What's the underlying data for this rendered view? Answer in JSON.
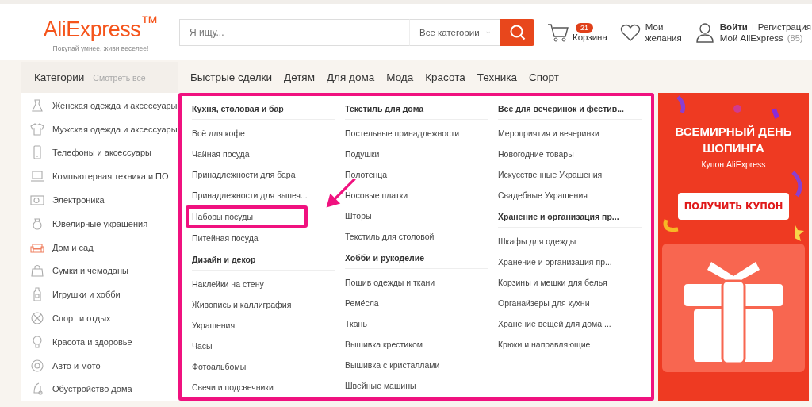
{
  "header": {
    "logo": "AliExpress$^{™}$",
    "tagline": "Покупай умнее, живи веселее!",
    "search": {
      "placeholder": "Я ищу...",
      "category": "Все категории"
    },
    "cart": {
      "count": "21",
      "label": "Корзина"
    },
    "wishlist": {
      "label": "Мои желания"
    },
    "account": {
      "login": "Войти",
      "separator": "|",
      "register": "Регистрация",
      "my": "Мой AliExpress",
      "count": "(85)"
    }
  },
  "categories": {
    "title": "Категории",
    "see_all": "Смотреть все",
    "items": [
      {
        "label": "Женская одежда и аксессуары",
        "selected": false
      },
      {
        "label": "Мужская одежда и аксессуары",
        "selected": false
      },
      {
        "label": "Телефоны и аксессуары",
        "selected": false
      },
      {
        "label": "Компьютерная техника и ПО",
        "selected": false
      },
      {
        "label": "Электроника",
        "selected": false
      },
      {
        "label": "Ювелирные украшения",
        "selected": false
      },
      {
        "label": "Дом и сад",
        "selected": true
      },
      {
        "label": "Сумки и чемоданы",
        "selected": false
      },
      {
        "label": "Игрушки и хобби",
        "selected": false
      },
      {
        "label": "Спорт и отдых",
        "selected": false
      },
      {
        "label": "Красота и здоровье",
        "selected": false
      },
      {
        "label": "Авто и мото",
        "selected": false
      },
      {
        "label": "Обустройство дома",
        "selected": false
      }
    ]
  },
  "nav": [
    "Быстрые сделки",
    "Детям",
    "Для дома",
    "Мода",
    "Красота",
    "Техника",
    "Спорт"
  ],
  "menu_columns": [
    {
      "groups": [
        {
          "title": "Кухня, столовая и бар",
          "items": [
            {
              "label": "Всё для кофе",
              "highlighted": false
            },
            {
              "label": "Чайная посуда",
              "highlighted": false
            },
            {
              "label": "Принадлежности для бара",
              "highlighted": false
            },
            {
              "label": "Принадлежности для выпеч...",
              "highlighted": false
            },
            {
              "label": "Наборы посуды",
              "highlighted": true
            },
            {
              "label": "Питейная посуда",
              "highlighted": false
            }
          ]
        },
        {
          "title": "Дизайн и декор",
          "items": [
            {
              "label": "Наклейки на стену",
              "highlighted": false
            },
            {
              "label": "Живопись и каллиграфия",
              "highlighted": false
            },
            {
              "label": "Украшения",
              "highlighted": false
            },
            {
              "label": "Часы",
              "highlighted": false
            },
            {
              "label": "Фотоальбомы",
              "highlighted": false
            },
            {
              "label": "Свечи и подсвечники",
              "highlighted": false
            }
          ]
        }
      ]
    },
    {
      "groups": [
        {
          "title": "Текстиль для дома",
          "items": [
            {
              "label": "Постельные принадлежности",
              "highlighted": false
            },
            {
              "label": "Подушки",
              "highlighted": false
            },
            {
              "label": "Полотенца",
              "highlighted": false
            },
            {
              "label": "Носовые платки",
              "highlighted": false
            },
            {
              "label": "Шторы",
              "highlighted": false
            },
            {
              "label": "Текстиль для столовой",
              "highlighted": false
            }
          ]
        },
        {
          "title": "Хобби и рукоделие",
          "items": [
            {
              "label": "Пошив одежды и ткани",
              "highlighted": false
            },
            {
              "label": "Ремёсла",
              "highlighted": false
            },
            {
              "label": "Ткань",
              "highlighted": false
            },
            {
              "label": "Вышивка крестиком",
              "highlighted": false
            },
            {
              "label": "Вышивка с кристаллами",
              "highlighted": false
            },
            {
              "label": "Швейные машины",
              "highlighted": false
            }
          ]
        }
      ]
    },
    {
      "groups": [
        {
          "title": "Все для вечеринок и фестив...",
          "items": [
            {
              "label": "Мероприятия и вечеринки",
              "highlighted": false
            },
            {
              "label": "Новогодние товары",
              "highlighted": false
            },
            {
              "label": "Искусственные Украшения",
              "highlighted": false
            },
            {
              "label": "Свадебные Украшения",
              "highlighted": false
            }
          ]
        },
        {
          "title": "Хранение и организация пр...",
          "items": [
            {
              "label": "Шкафы для одежды",
              "highlighted": false
            },
            {
              "label": "Хранение и организация пр...",
              "highlighted": false
            },
            {
              "label": "Корзины и мешки для белья",
              "highlighted": false
            },
            {
              "label": "Органайзеры для кухни",
              "highlighted": false
            },
            {
              "label": "Хранение вещей для дома ...",
              "highlighted": false
            },
            {
              "label": "Крюки и направляющие",
              "highlighted": false
            }
          ]
        }
      ]
    }
  ],
  "banner": {
    "title": "ВСЕМИРНЫЙ ДЕНЬ ШОПИНГА",
    "subtitle": "Купон AliExpress",
    "button": "ПОЛУЧИТЬ КУПОН"
  }
}
